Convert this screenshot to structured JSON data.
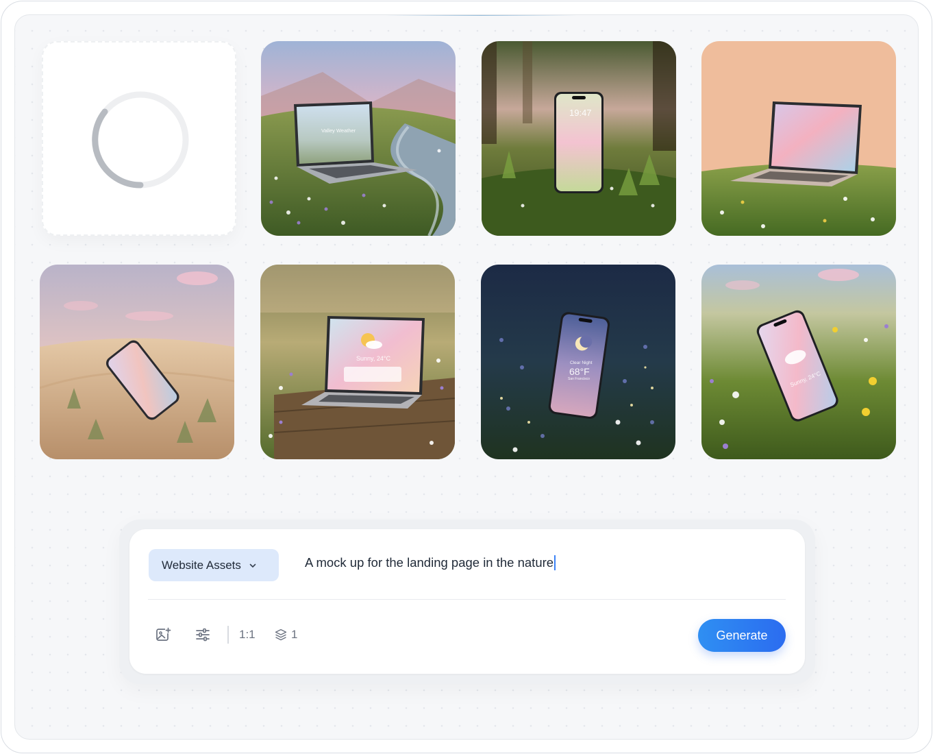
{
  "gallery": {
    "tiles": [
      {
        "id": "loading",
        "status": "loading"
      },
      {
        "id": "laptop-valley-stream",
        "screen_title": "Valley Weather",
        "screen_subtitle": ""
      },
      {
        "id": "phone-forest",
        "screen_time": "19:47"
      },
      {
        "id": "laptop-peach-meadow"
      },
      {
        "id": "phone-desert-dune"
      },
      {
        "id": "laptop-wooden-deck",
        "screen_weather": "Sunny, 24°C"
      },
      {
        "id": "phone-night-meadow",
        "screen_condition": "Clear Night",
        "screen_temp": "68°F",
        "screen_city": "San Francisco"
      },
      {
        "id": "phone-grass-flowers",
        "screen_weather": "Sunny, 24°C"
      }
    ]
  },
  "composer": {
    "category_label": "Website Assets",
    "prompt_value": "A mock up for the landing page in the nature",
    "toolbar": {
      "add_image_icon": "image-plus-icon",
      "settings_icon": "sliders-icon",
      "aspect_ratio": "1:1",
      "count_icon": "layers-icon",
      "image_count": "1"
    },
    "generate_label": "Generate"
  },
  "colors": {
    "accent": "#2b6cf0",
    "dropdown_bg": "#dde9fb",
    "canvas_bg": "#f6f7f9"
  }
}
